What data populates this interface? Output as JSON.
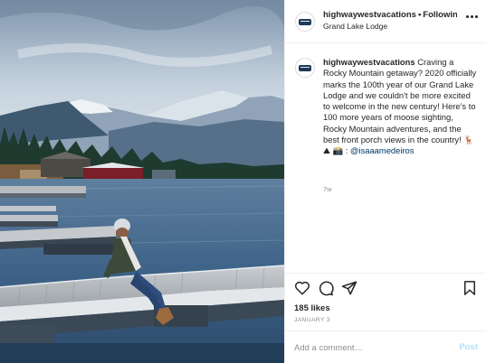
{
  "post": {
    "username": "highwaywestvacations",
    "follow_status": "Following",
    "location": "Grand Lake Lodge",
    "caption": {
      "text_before_mention": " Craving a Rocky Mountain getaway? 2020 officially marks the 100th year of our Grand Lake Lodge and we couldn't be more excited to welcome in the new century! Here's to 100 more years of moose sighting, Rocky Mountain adventures, and the best front porch views in the country! 🦌 ⛰ 📸 : ",
      "mention": "@isaaamedeiros"
    },
    "time_ago": "7w",
    "likes": "185 likes",
    "date": "JANUARY 3"
  },
  "comment_box": {
    "placeholder": "Add a comment…",
    "post_label": "Post"
  },
  "icons": [
    "avatar-logo",
    "more-options-icon",
    "heart-icon",
    "comment-icon",
    "share-icon",
    "bookmark-icon"
  ],
  "colors": {
    "text": "#262626",
    "secondary": "#8e8e8e",
    "mention": "#003569",
    "post_button": "#b2dffc",
    "border": "#efefef"
  }
}
